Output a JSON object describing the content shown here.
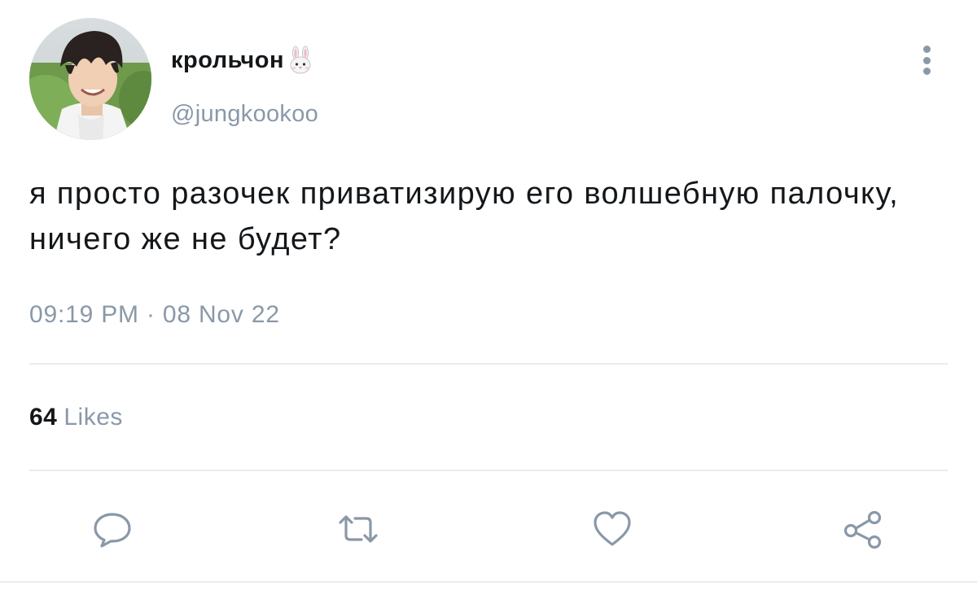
{
  "tweet": {
    "author": {
      "display_name": "крольчон",
      "name_emoji": "rabbit-face-icon",
      "handle": "@jungkookoo",
      "avatar": "profile-photo"
    },
    "text": "я просто разочек приватизирую его волшебную палочку, ничего же не будет?",
    "timestamp": "09:19 PM · 08 Nov 22",
    "stats": {
      "likes_count": "64",
      "likes_label": "Likes"
    },
    "actions": [
      {
        "name": "reply",
        "icon": "speech-bubble-icon"
      },
      {
        "name": "retweet",
        "icon": "retweet-icon"
      },
      {
        "name": "like",
        "icon": "heart-icon"
      },
      {
        "name": "share",
        "icon": "share-icon"
      }
    ],
    "menu_icon": "more-vertical-icon"
  },
  "colors": {
    "text": "#14171a",
    "secondary": "#8a98a8",
    "divider": "#e6ecf0",
    "icon": "#8a98a8"
  }
}
